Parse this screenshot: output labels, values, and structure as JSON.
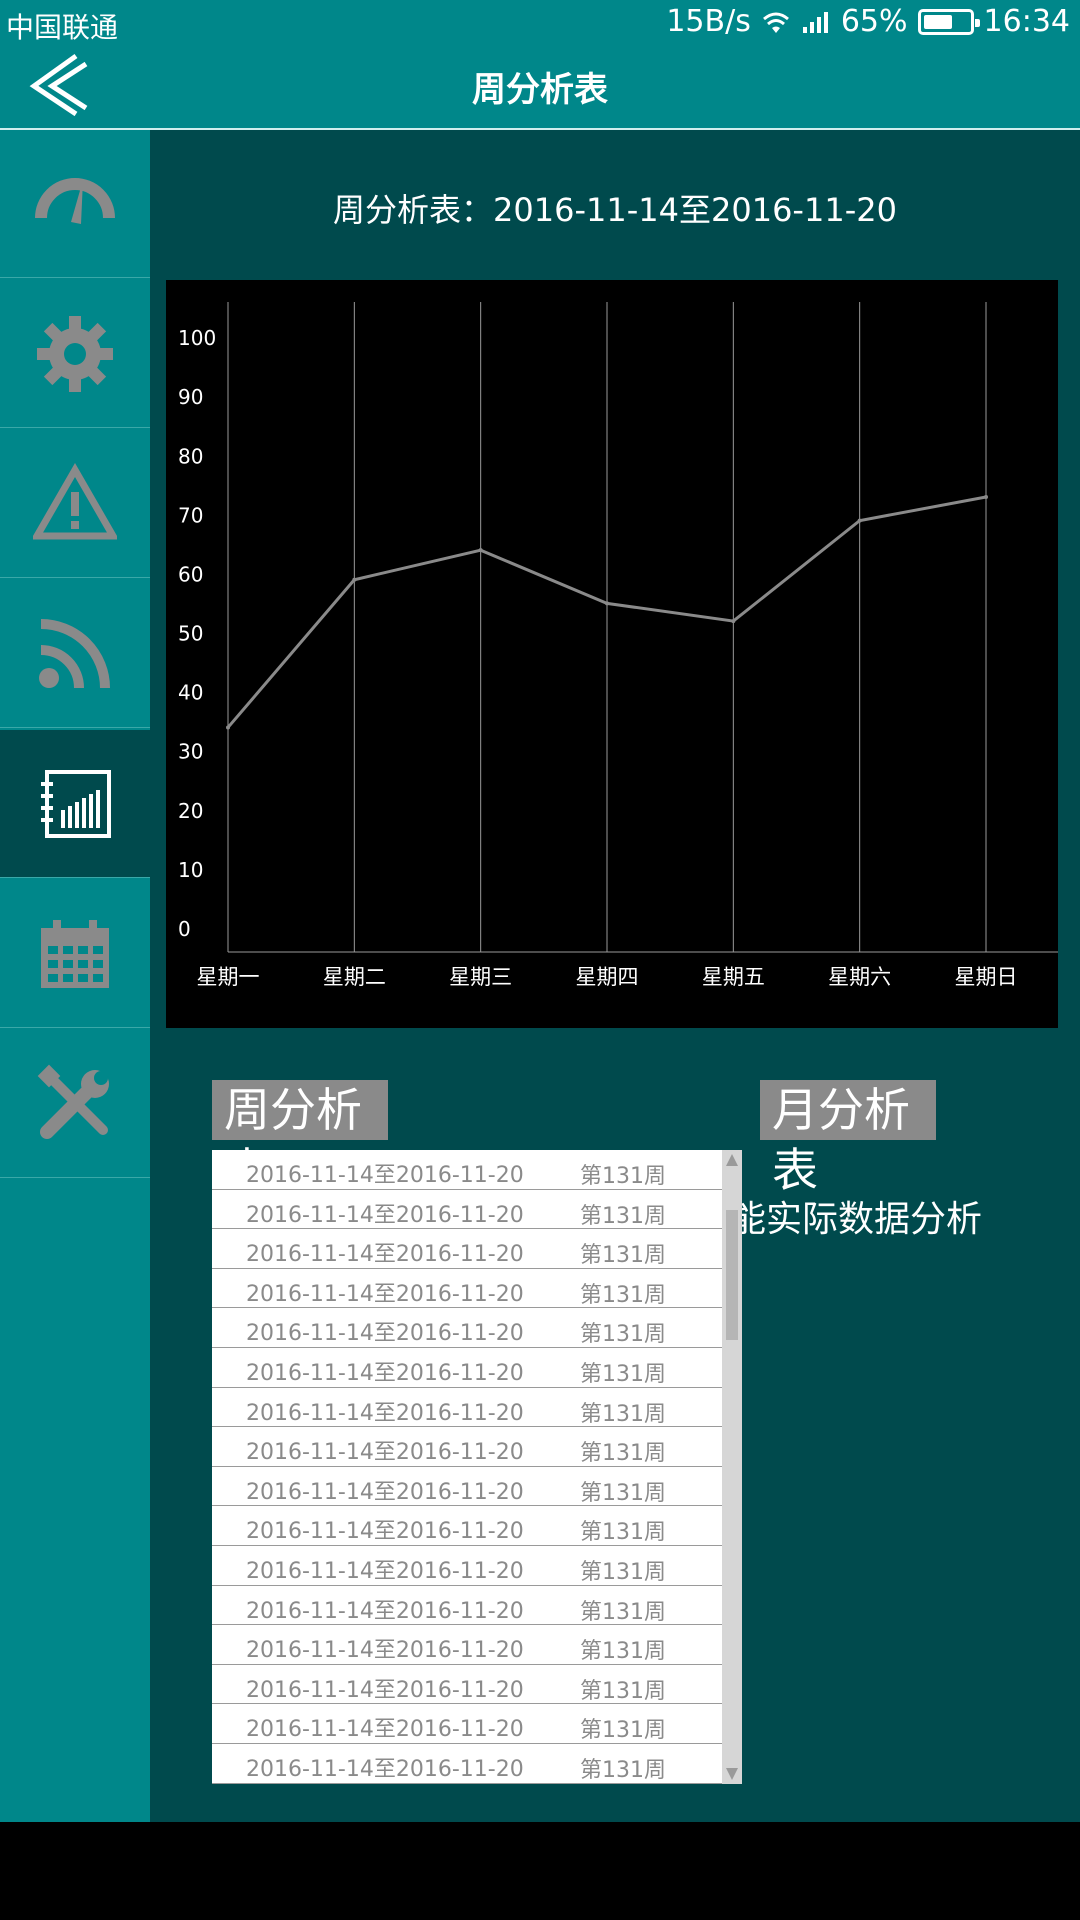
{
  "status_bar": {
    "carrier": "中国联通",
    "speed": "15B/s",
    "battery": "65%",
    "battery_level": 0.65,
    "time": "16:34"
  },
  "header": {
    "title": "周分析表",
    "back_icon": "chevron-left-icon"
  },
  "sidebar": {
    "items": [
      {
        "icon": "gauge-icon",
        "active": false
      },
      {
        "icon": "gear-icon",
        "active": false
      },
      {
        "icon": "warning-icon",
        "active": false
      },
      {
        "icon": "rss-icon",
        "active": false
      },
      {
        "icon": "report-icon",
        "active": true
      },
      {
        "icon": "calendar-icon",
        "active": false
      },
      {
        "icon": "tools-icon",
        "active": false
      }
    ]
  },
  "main": {
    "chart_heading": "周分析表：2016-11-14至2016-11-20",
    "tab_week": "周分析表",
    "tab_month": "月分析表",
    "desc_text": "能实际数据分析",
    "dropdown_rows": [
      {
        "range": "2016-11-14至2016-11-20",
        "week": "第131周"
      },
      {
        "range": "2016-11-14至2016-11-20",
        "week": "第131周"
      },
      {
        "range": "2016-11-14至2016-11-20",
        "week": "第131周"
      },
      {
        "range": "2016-11-14至2016-11-20",
        "week": "第131周"
      },
      {
        "range": "2016-11-14至2016-11-20",
        "week": "第131周"
      },
      {
        "range": "2016-11-14至2016-11-20",
        "week": "第131周"
      },
      {
        "range": "2016-11-14至2016-11-20",
        "week": "第131周"
      },
      {
        "range": "2016-11-14至2016-11-20",
        "week": "第131周"
      },
      {
        "range": "2016-11-14至2016-11-20",
        "week": "第131周"
      },
      {
        "range": "2016-11-14至2016-11-20",
        "week": "第131周"
      },
      {
        "range": "2016-11-14至2016-11-20",
        "week": "第131周"
      },
      {
        "range": "2016-11-14至2016-11-20",
        "week": "第131周"
      },
      {
        "range": "2016-11-14至2016-11-20",
        "week": "第131周"
      },
      {
        "range": "2016-11-14至2016-11-20",
        "week": "第131周"
      },
      {
        "range": "2016-11-14至2016-11-20",
        "week": "第131周"
      },
      {
        "range": "2016-11-14至2016-11-20",
        "week": "第131周"
      }
    ]
  },
  "colors": {
    "header": "#00878a",
    "sidebar_active": "#004a4d",
    "main_bg": "#004a4d",
    "chart_line": "#8a8a8a",
    "tab_bg": "#8a8a8a"
  },
  "chart_data": {
    "type": "line",
    "categories": [
      "星期一",
      "星期二",
      "星期三",
      "星期四",
      "星期五",
      "星期六",
      "星期日"
    ],
    "series": [
      {
        "values": [
          38,
          63,
          68,
          59,
          56,
          73,
          77
        ]
      }
    ],
    "yticks": [
      0,
      10,
      20,
      30,
      40,
      50,
      60,
      70,
      80,
      90,
      100
    ],
    "ylim": [
      0,
      110
    ],
    "grid": "vertical",
    "title": "",
    "xlabel": "",
    "ylabel": ""
  }
}
